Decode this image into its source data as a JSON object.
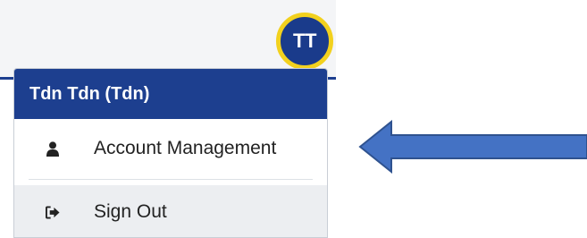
{
  "user": {
    "initials": "TT",
    "display_name": "Tdn Tdn (Tdn)"
  },
  "menu": {
    "items": [
      {
        "label": "Account Management",
        "icon": "user-icon"
      },
      {
        "label": "Sign Out",
        "icon": "sign-out-icon"
      }
    ]
  },
  "colors": {
    "header_blue": "#1d3f8f",
    "avatar_ring": "#f2d11e",
    "arrow_fill": "#4472c4",
    "arrow_stroke": "#2f528f"
  }
}
